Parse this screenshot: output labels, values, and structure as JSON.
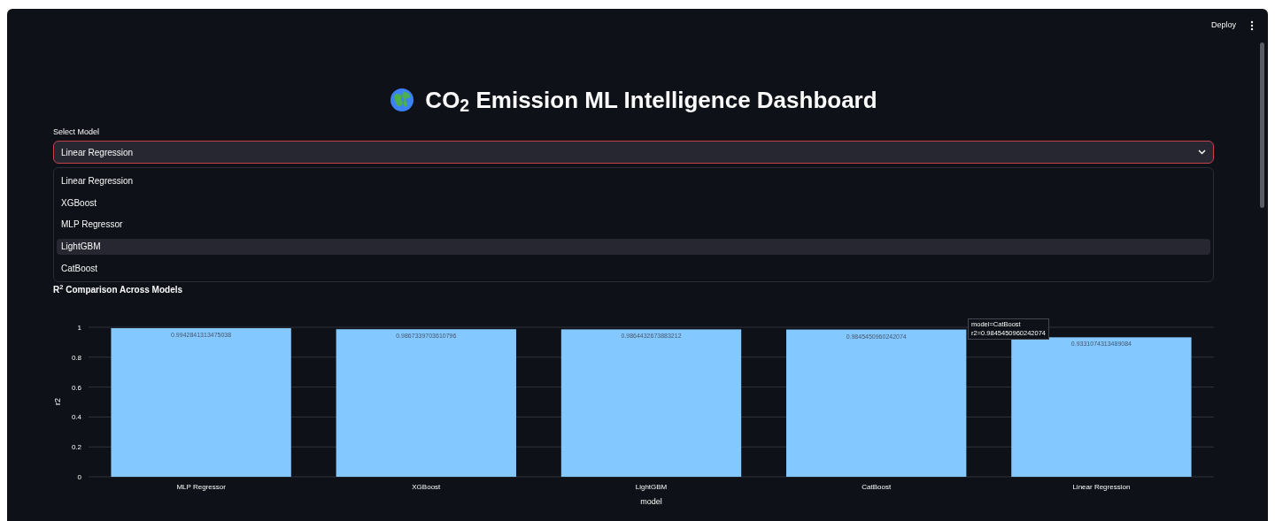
{
  "header": {
    "deploy": "Deploy"
  },
  "title": "CO$_{2}$ Emission ML Intelligence Dashboard",
  "model_select": {
    "label": "Select Model",
    "value": "Linear Regression",
    "expanded": true,
    "options": [
      {
        "label": "Linear Regression",
        "highlighted": false
      },
      {
        "label": "XGBoost",
        "highlighted": false
      },
      {
        "label": "MLP Regressor",
        "highlighted": false
      },
      {
        "label": "LightGBM",
        "highlighted": true
      },
      {
        "label": "CatBoost",
        "highlighted": false
      }
    ]
  },
  "chart_title": "R$^{2}$ Comparison Across Models",
  "chart": {
    "chart_data": {
      "type": "bar",
      "xlabel": "model",
      "ylabel": "r2",
      "categories": [
        "MLP Regressor",
        "XGBoost",
        "LightGBM",
        "CatBoost",
        "Linear Regression"
      ],
      "series": [
        {
          "color": "#83c9ff",
          "values": [
            0.994,
            0.987,
            0.986,
            0.985,
            0.933
          ]
        }
      ],
      "grid": true,
      "value_labels": [
        "0.9942841313475038",
        "0.9867339703610796",
        "0.9864432673883212",
        "0.9845450960242074",
        "0.9331074313489084"
      ],
      "ylim": [
        0,
        1
      ],
      "yticks": [
        0,
        0.2,
        0.4,
        0.6,
        0.8,
        1
      ]
    },
    "tooltip": [
      "model=CatBoost",
      "r2=0.9845450960242074"
    ]
  }
}
